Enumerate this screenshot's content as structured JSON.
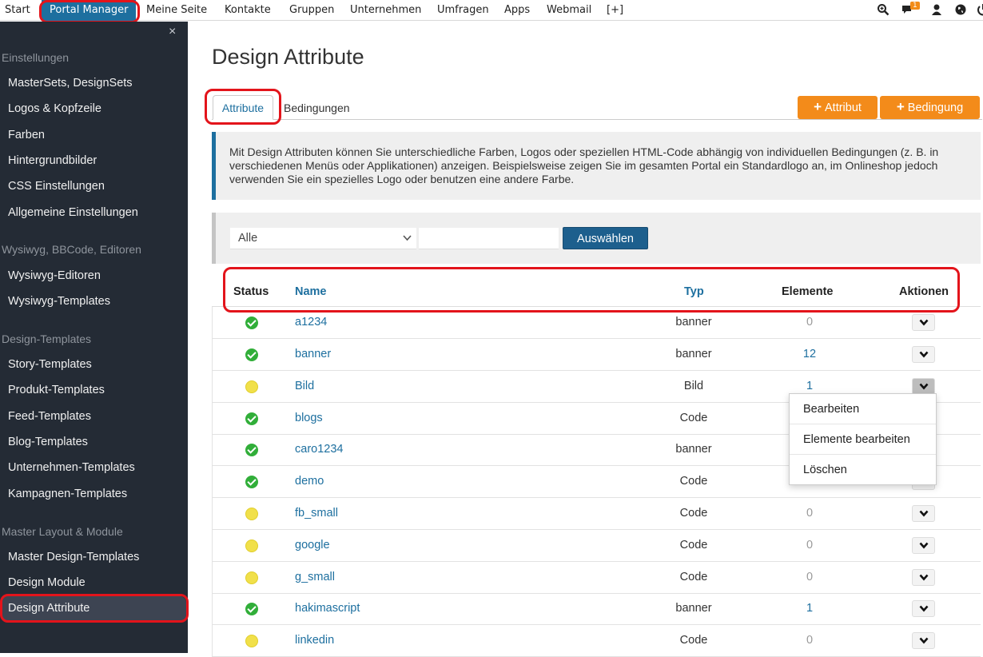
{
  "topnav": {
    "items": [
      "Start",
      "Portal Manager",
      "Meine Seite",
      "Kontakte",
      "Gruppen",
      "Unternehmen",
      "Umfragen",
      "Apps",
      "Webmail",
      "[+]"
    ],
    "messages_badge": "1",
    "icons": [
      "search-zoom-icon",
      "messages-icon",
      "user-icon",
      "globe-icon",
      "power-icon"
    ]
  },
  "sidebar": {
    "close": "×",
    "groups": [
      {
        "title": "Einstellungen",
        "items": [
          "MasterSets, DesignSets",
          "Logos & Kopfzeile",
          "Farben",
          "Hintergrundbilder",
          "CSS Einstellungen",
          "Allgemeine Einstellungen"
        ]
      },
      {
        "title": "Wysiwyg, BBCode, Editoren",
        "items": [
          "Wysiwyg-Editoren",
          "Wysiwyg-Templates"
        ]
      },
      {
        "title": "Design-Templates",
        "items": [
          "Story-Templates",
          "Produkt-Templates",
          "Feed-Templates",
          "Blog-Templates",
          "Unternehmen-Templates",
          "Kampagnen-Templates"
        ]
      },
      {
        "title": "Master Layout & Module",
        "items": [
          "Master Design-Templates",
          "Design Module",
          "Design Attribute"
        ]
      }
    ]
  },
  "page": {
    "title": "Design Attribute",
    "tabs": [
      "Attribute",
      "Bedingungen"
    ],
    "buttons": {
      "add_attribute": "Attribut",
      "add_condition": "Bedingung",
      "plus": "+"
    },
    "info": "Mit Design Attributen können Sie unterschiedliche Farben, Logos oder speziellen HTML-Code abhängig von individuellen Bedingungen (z. B. in verschiedenen Menüs oder Applikationen) anzeigen. Beispielsweise zeigen Sie im gesamten Portal ein Standardlogo an, im Onlineshop jedoch verwenden Sie ein spezielles Logo oder benutzen eine andere Farbe.",
    "filter": {
      "select_value": "Alle",
      "button": "Auswählen"
    },
    "colors": {
      "accent": "#1d6f9f",
      "orange": "#f38b1a",
      "sidebar": "#242b35",
      "highlight": "#e3141b"
    }
  },
  "table": {
    "headers": [
      "Status",
      "Name",
      "Typ",
      "Elemente",
      "Aktionen"
    ],
    "rows": [
      {
        "status": "ok",
        "name": "a1234",
        "typ": "banner",
        "elemente": "0"
      },
      {
        "status": "ok",
        "name": "banner",
        "typ": "banner",
        "elemente": "12"
      },
      {
        "status": "warn",
        "name": "Bild",
        "typ": "Bild",
        "elemente": "1"
      },
      {
        "status": "ok",
        "name": "blogs",
        "typ": "Code",
        "elemente": ""
      },
      {
        "status": "ok",
        "name": "caro1234",
        "typ": "banner",
        "elemente": ""
      },
      {
        "status": "ok",
        "name": "demo",
        "typ": "Code",
        "elemente": ""
      },
      {
        "status": "warn",
        "name": "fb_small",
        "typ": "Code",
        "elemente": "0"
      },
      {
        "status": "warn",
        "name": "google",
        "typ": "Code",
        "elemente": "0"
      },
      {
        "status": "warn",
        "name": "g_small",
        "typ": "Code",
        "elemente": "0"
      },
      {
        "status": "ok",
        "name": "hakimascript",
        "typ": "banner",
        "elemente": "1"
      },
      {
        "status": "warn",
        "name": "linkedin",
        "typ": "Code",
        "elemente": "0"
      }
    ],
    "dropdown": [
      "Bearbeiten",
      "Elemente bearbeiten",
      "Löschen"
    ]
  }
}
